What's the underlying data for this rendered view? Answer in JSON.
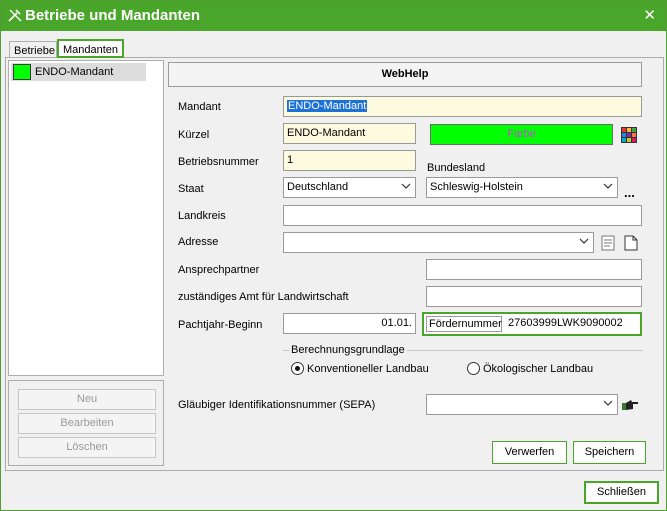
{
  "window": {
    "title": "Betriebe und Mandanten",
    "close_glyph": "✕"
  },
  "tabs": [
    {
      "label": "Betriebe"
    },
    {
      "label": "Mandanten"
    }
  ],
  "list": {
    "items": [
      {
        "label": "ENDO-Mandant",
        "color": "#00ff00"
      }
    ]
  },
  "left_buttons": {
    "neu": "Neu",
    "bearbeiten": "Bearbeiten",
    "loeschen": "Löschen"
  },
  "webhelp": "WebHelp",
  "form": {
    "mandant": {
      "label": "Mandant",
      "value": "ENDO-Mandant"
    },
    "kuerzel": {
      "label": "Kürzel",
      "value": "ENDO-Mandant"
    },
    "farbe": {
      "label": "Farbe",
      "color": "#00ff00"
    },
    "betriebsnummer": {
      "label": "Betriebsnummer",
      "value": "1"
    },
    "bundesland": {
      "label": "Bundesland",
      "value": "Schleswig-Holstein"
    },
    "staat": {
      "label": "Staat",
      "value": "Deutschland"
    },
    "more": "...",
    "landkreis": {
      "label": "Landkreis",
      "value": ""
    },
    "adresse": {
      "label": "Adresse",
      "value": ""
    },
    "ansprechpartner": {
      "label": "Ansprechpartner",
      "value": ""
    },
    "amt": {
      "label": "zuständiges Amt für Landwirtschaft",
      "value": ""
    },
    "pachtjahr": {
      "label": "Pachtjahr-Beginn",
      "value": "01.01."
    },
    "foerdernummer": {
      "label": "Fördernummer",
      "value": "27603999LWK9090002"
    },
    "berechnung": {
      "label": "Berechnungsgrundlage",
      "options": [
        "Konventioneller Landbau",
        "Ökologischer Landbau"
      ],
      "selected": 0
    },
    "glaeubiger": {
      "label": "Gläubiger Identifikationsnummer (SEPA)",
      "value": ""
    }
  },
  "buttons": {
    "verwerfen": "Verwerfen",
    "speichern": "Speichern",
    "schliessen": "Schließen"
  },
  "colors": {
    "accent": "#4aa52b",
    "input_yellow": "#fdfbdf",
    "farbe_text": "#c64bd6"
  }
}
